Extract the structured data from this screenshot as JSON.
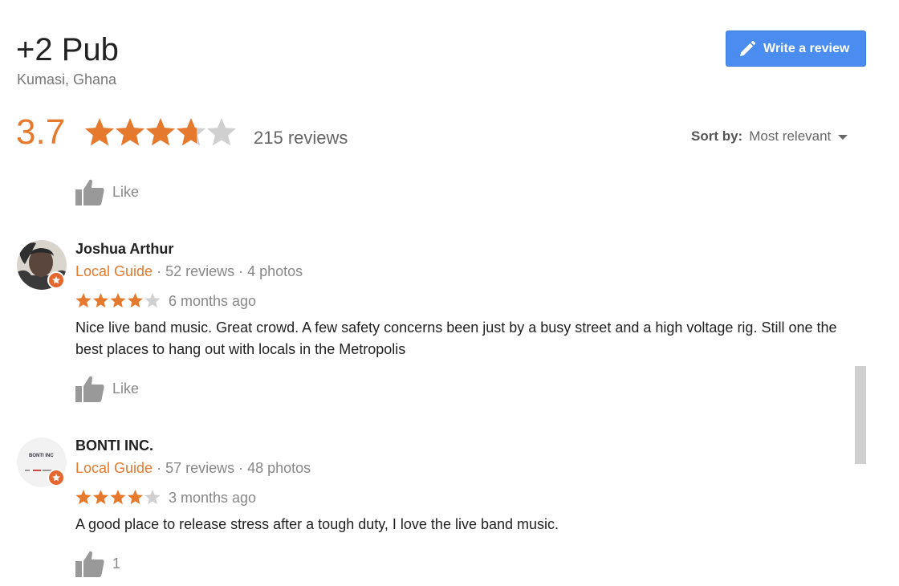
{
  "place": {
    "name": "+2 Pub",
    "location": "Kumasi, Ghana",
    "rating": "3.7",
    "rating_value": 3.7,
    "review_count": "215 reviews"
  },
  "header": {
    "write_review_label": "Write a review"
  },
  "sort": {
    "label": "Sort by:",
    "value": "Most relevant"
  },
  "prev_review": {
    "like_label": "Like"
  },
  "reviews": [
    {
      "name": "Joshua Arthur",
      "guide_label": "Local Guide",
      "stats": " · 52 reviews · 4 photos",
      "stars": 4,
      "time": "6 months ago",
      "text": "Nice live band music. Great crowd. A few safety concerns been just by a busy street and a high voltage rig. Still one the best places to hang out with locals in the Metropolis",
      "like_label": "Like"
    },
    {
      "name": "BONTI INC.",
      "guide_label": "Local Guide",
      "stats": " · 57 reviews · 48 photos",
      "stars": 4,
      "time": "3 months ago",
      "text": "A good place to release stress after a tough duty, I love the live band music.",
      "like_label": "1",
      "avatar_logo_text": "BONTI INC"
    }
  ],
  "colors": {
    "accent": "#e57a2e",
    "button": "#4a8cf0",
    "star_empty": "#d0d0d0"
  }
}
